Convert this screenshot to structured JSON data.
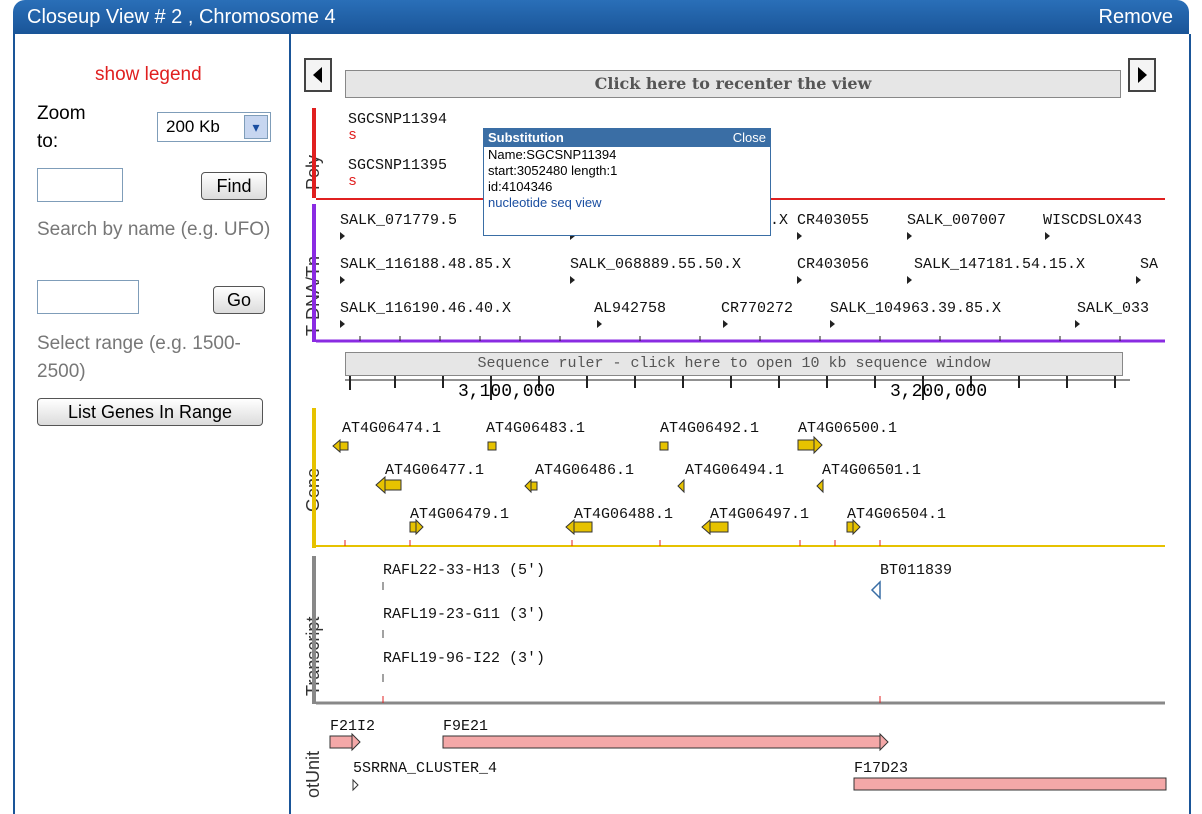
{
  "window": {
    "title": "Closeup View # 2 , Chromosome 4",
    "remove_label": "Remove"
  },
  "left": {
    "show_legend": "show legend",
    "zoom_label": "Zoom to:",
    "zoom_value": "200 Kb",
    "find_label": "Find",
    "search_hint": "Search by name (e.g. UFO)",
    "go_label": "Go",
    "range_hint": "Select range (e.g. 1500-2500)",
    "list_genes_label": "List Genes In Range"
  },
  "nav": {
    "recenter": "Click here to recenter the view"
  },
  "ruler": {
    "label": "Sequence ruler - click here to open 10 kb sequence window",
    "ticks": [
      "3,100,000",
      "3,200,000"
    ]
  },
  "tracks": {
    "poly": "Poly",
    "tdna": "T-DNA/Tn",
    "gene": "Gene",
    "transcript": "Transcript",
    "cloneunit": "otUnit"
  },
  "poly_features": [
    "SGCSNP11394",
    "SGCSNP11395"
  ],
  "tdna_rows": [
    [
      "SALK_071779.5",
      ".X",
      "CR403055",
      "SALK_007007",
      "WISCDSLOX43"
    ],
    [
      "SALK_116188.48.85.X",
      "SALK_068889.55.50.X",
      "CR403056",
      "SALK_147181.54.15.X",
      "SA"
    ],
    [
      "SALK_116190.46.40.X",
      "AL942758",
      "CR770272",
      "SALK_104963.39.85.X",
      "SALK_033"
    ]
  ],
  "gene_rows": [
    [
      "AT4G06474.1",
      "AT4G06483.1",
      "AT4G06492.1",
      "AT4G06500.1"
    ],
    [
      "AT4G06477.1",
      "AT4G06486.1",
      "AT4G06494.1",
      "AT4G06501.1"
    ],
    [
      "AT4G06479.1",
      "AT4G06488.1",
      "AT4G06497.1",
      "AT4G06504.1"
    ]
  ],
  "transcripts": [
    "RAFL22-33-H13 (5')",
    "RAFL19-23-G11 (3')",
    "RAFL19-96-I22 (3')",
    "BT011839"
  ],
  "clones": [
    "F21I2",
    "F9E21",
    "5SRRNA_CLUSTER_4",
    "F17D23"
  ],
  "popup": {
    "title": "Substitution",
    "close": "Close",
    "name": "Name:SGCSNP11394",
    "start": "start:3052480 length:1",
    "id": "id:4104346",
    "link": "nucleotide seq view"
  }
}
